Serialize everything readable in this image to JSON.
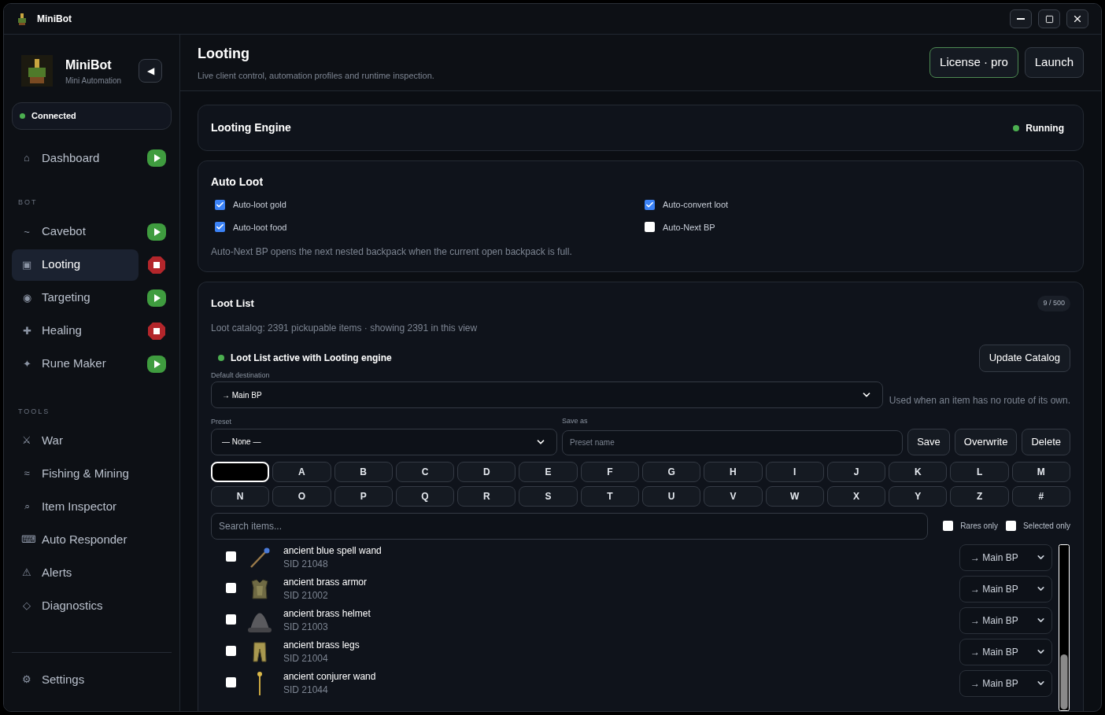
{
  "window": {
    "title": "MiniBot"
  },
  "sidebar": {
    "brand": "MiniBot",
    "tagline": "Mini Automation",
    "collapse_glyph": "◀",
    "connection": {
      "label": "Connected",
      "color": "#4caf50"
    },
    "top_items": [
      {
        "glyph": "⌂",
        "label": "Dashboard",
        "selected": false,
        "running": false
      }
    ],
    "sections": [
      {
        "heading": "BOT",
        "items": [
          {
            "glyph": "~",
            "label": "Cavebot",
            "selected": false,
            "running": false
          },
          {
            "glyph": "▣",
            "label": "Looting",
            "selected": true,
            "running": true
          },
          {
            "glyph": "◉",
            "label": "Targeting",
            "selected": false,
            "running": false
          },
          {
            "glyph": "✚",
            "label": "Healing",
            "selected": false,
            "running": true
          },
          {
            "glyph": "✦",
            "label": "Rune Maker",
            "selected": false,
            "running": false
          }
        ]
      },
      {
        "heading": "TOOLS",
        "items": [
          {
            "glyph": "⚔",
            "label": "War",
            "selected": false
          },
          {
            "glyph": "≈",
            "label": "Fishing & Mining",
            "selected": false
          },
          {
            "glyph": "⌕",
            "label": "Item Inspector",
            "selected": false
          },
          {
            "glyph": "⌨",
            "label": "Auto Responder",
            "selected": false
          },
          {
            "glyph": "⚠",
            "label": "Alerts",
            "selected": false
          },
          {
            "glyph": "◇",
            "label": "Diagnostics",
            "selected": false
          }
        ]
      }
    ],
    "footer_item": {
      "glyph": "⚙",
      "label": "Settings",
      "selected": false
    }
  },
  "header": {
    "title": "Looting",
    "subtitle": "Live client control, automation profiles and runtime inspection.",
    "buttons": [
      {
        "label": "License · pro",
        "kind": "accent"
      },
      {
        "label": "Launch",
        "kind": "plain"
      }
    ]
  },
  "engine": {
    "title": "Looting Engine",
    "status": "Running",
    "color": "#4caf50"
  },
  "auto_loot": {
    "title": "Auto Loot",
    "options": [
      {
        "label": "Auto-loot gold",
        "checked": true
      },
      {
        "label": "Auto-convert loot",
        "checked": true
      },
      {
        "label": "Auto-loot food",
        "checked": true
      },
      {
        "label": "Auto-Next BP",
        "checked": false
      }
    ],
    "note": "Auto-Next BP opens the next nested backpack when the current open backpack is full."
  },
  "loot_list": {
    "title": "Loot List",
    "count": "9 / 500",
    "summary": "Loot catalog: 2391 pickupable items · showing 2391 in this view",
    "active": {
      "label": "Loot List active with Looting engine",
      "color": "#4caf50"
    },
    "update_button": "Update Catalog",
    "default_destination": {
      "label": "Default destination",
      "value": "→ Main BP",
      "hint": "Used when an item has no route of its own."
    },
    "preset": {
      "label": "Preset",
      "value": "— None —"
    },
    "save_as": {
      "label": "Save as",
      "placeholder": "Preset name"
    },
    "preset_buttons": [
      "Save",
      "Overwrite",
      "Delete"
    ],
    "letters": [
      {
        "kind": "blank",
        "selected": true
      },
      {
        "label": "A",
        "selected": false
      },
      {
        "label": "B",
        "selected": false
      },
      {
        "label": "C",
        "selected": false
      },
      {
        "label": "D",
        "selected": false
      },
      {
        "label": "E",
        "selected": false
      },
      {
        "label": "F",
        "selected": false
      },
      {
        "label": "G",
        "selected": false
      },
      {
        "label": "H",
        "selected": false
      },
      {
        "label": "I",
        "selected": false
      },
      {
        "label": "J",
        "selected": false
      },
      {
        "label": "K",
        "selected": false
      },
      {
        "label": "L",
        "selected": false
      },
      {
        "label": "M",
        "selected": false
      },
      {
        "label": "N",
        "selected": false
      },
      {
        "label": "O",
        "selected": false
      },
      {
        "label": "P",
        "selected": false
      },
      {
        "label": "Q",
        "selected": false
      },
      {
        "label": "R",
        "selected": false
      },
      {
        "label": "S",
        "selected": false
      },
      {
        "label": "T",
        "selected": false
      },
      {
        "label": "U",
        "selected": false
      },
      {
        "label": "V",
        "selected": false
      },
      {
        "label": "W",
        "selected": false
      },
      {
        "label": "X",
        "selected": false
      },
      {
        "label": "Y",
        "selected": false
      },
      {
        "label": "Z",
        "selected": false
      },
      {
        "label": "#",
        "selected": false
      }
    ],
    "search": {
      "placeholder": "Search items..."
    },
    "filters": [
      {
        "label": "Rares only",
        "checked": false
      },
      {
        "label": "Selected only",
        "checked": false
      }
    ],
    "items": [
      {
        "kind": "wand",
        "name": "ancient blue spell wand",
        "sid": "SID 21048",
        "checked": false,
        "destination": "→ Main BP"
      },
      {
        "kind": "armor",
        "name": "ancient brass armor",
        "sid": "SID 21002",
        "checked": false,
        "destination": "→ Main BP"
      },
      {
        "kind": "helmet",
        "name": "ancient brass helmet",
        "sid": "SID 21003",
        "checked": false,
        "destination": "→ Main BP"
      },
      {
        "kind": "legs",
        "name": "ancient brass legs",
        "sid": "SID 21004",
        "checked": false,
        "destination": "→ Main BP"
      },
      {
        "kind": "rod",
        "name": "ancient conjurer wand",
        "sid": "SID 21044",
        "checked": false,
        "destination": "→ Main BP"
      }
    ]
  }
}
